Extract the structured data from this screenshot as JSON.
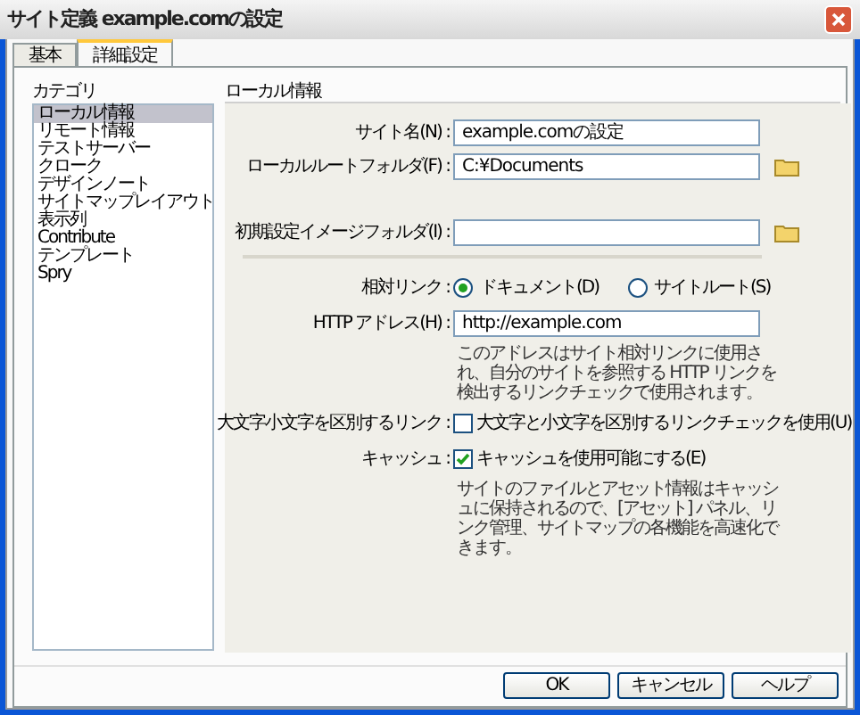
{
  "window": {
    "title": "サイト定義 example.comの設定"
  },
  "tabs": [
    {
      "label": "基本",
      "selected": false
    },
    {
      "label": "詳細設定",
      "selected": true
    }
  ],
  "category": {
    "label": "カテゴリ",
    "items": [
      {
        "label": "ローカル情報",
        "selected": true
      },
      {
        "label": "リモート情報",
        "selected": false
      },
      {
        "label": "テストサーバー",
        "selected": false
      },
      {
        "label": "クローク",
        "selected": false
      },
      {
        "label": "デザインノート",
        "selected": false
      },
      {
        "label": "サイトマップレイアウト",
        "selected": false
      },
      {
        "label": "表示列",
        "selected": false
      },
      {
        "label": "Contribute",
        "selected": false
      },
      {
        "label": "テンプレート",
        "selected": false
      },
      {
        "label": "Spry",
        "selected": false
      }
    ]
  },
  "panel": {
    "title": "ローカル情報",
    "rows": [
      {
        "kind": "field",
        "label": "サイト名(N) :",
        "value": "example.comの設定",
        "browse": false
      },
      {
        "kind": "field",
        "label": "ローカルルートフォルダ(F) :",
        "value": "C:¥Documents",
        "browse": true
      },
      {
        "kind": "spacer"
      },
      {
        "kind": "field",
        "label": "初期設定イメージフォルダ(I) :",
        "value": "",
        "browse": true
      },
      {
        "kind": "divider"
      },
      {
        "kind": "radio",
        "label": "相対リンク :",
        "options": [
          {
            "label": "ドキュメント(D)",
            "selected": true
          },
          {
            "label": "サイトルート(S)",
            "selected": false
          }
        ]
      },
      {
        "kind": "field",
        "label": "HTTP アドレス(H) :",
        "value": "http://example.com",
        "browse": false
      },
      {
        "kind": "note",
        "text": "このアドレスはサイト相対リンクに使用され、自分のサイトを参照する HTTP リンクを検出するリンクチェックで使用されます。"
      },
      {
        "kind": "checkbox",
        "label": "大文字小文字を区別するリンク :",
        "option": "大文字と小文字を区別するリンクチェックを使用(U)",
        "checked": false
      },
      {
        "kind": "checkbox",
        "label": "キャッシュ :",
        "option": "キャッシュを使用可能にする(E)",
        "checked": true
      },
      {
        "kind": "note",
        "text": "サイトのファイルとアセット情報はキャッシュに保持されるので、[アセット] パネル、リンク管理、サイトマップの各機能を高速化できます。"
      }
    ]
  },
  "buttons": [
    "OK",
    "キャンセル",
    "ヘルプ"
  ]
}
